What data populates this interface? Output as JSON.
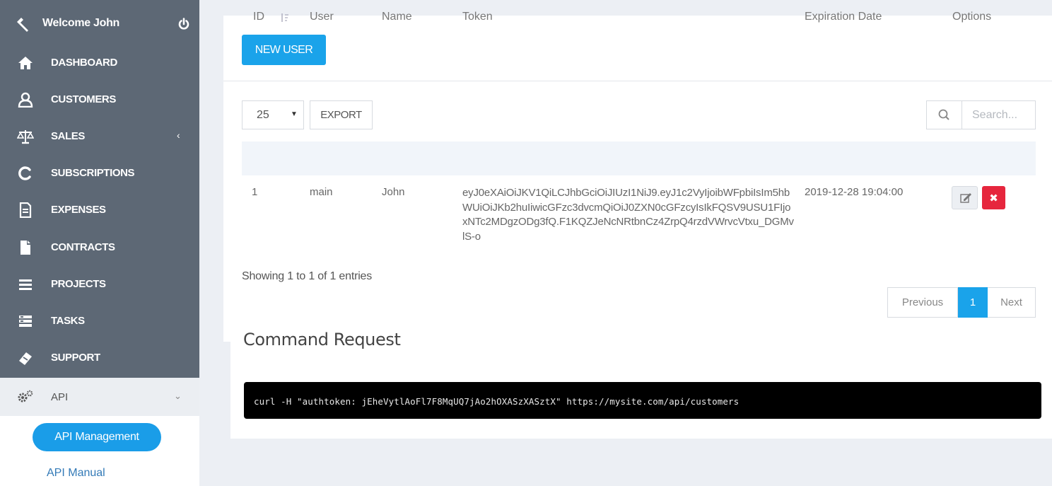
{
  "sidebar": {
    "welcome": "Welcome John",
    "items": [
      {
        "label": "DASHBOARD",
        "icon": "home-icon"
      },
      {
        "label": "CUSTOMERS",
        "icon": "user-icon"
      },
      {
        "label": "SALES",
        "icon": "balance-scale-icon",
        "chevron": "‹"
      },
      {
        "label": "SUBSCRIPTIONS",
        "icon": "refresh-c-icon"
      },
      {
        "label": "EXPENSES",
        "icon": "document-icon"
      },
      {
        "label": "CONTRACTS",
        "icon": "file-icon"
      },
      {
        "label": "PROJECTS",
        "icon": "bars-icon"
      },
      {
        "label": "TASKS",
        "icon": "tasks-list-icon"
      },
      {
        "label": "SUPPORT",
        "icon": "ticket-icon"
      }
    ],
    "api": {
      "label": "API",
      "icon": "cogs-icon",
      "chevron": "⌄"
    },
    "api_management": "API Management",
    "api_manual": "API Manual"
  },
  "toolbar": {
    "new_user": "NEW USER"
  },
  "table_controls": {
    "page_length": "25",
    "export": "EXPORT",
    "search_placeholder": "Search..."
  },
  "table": {
    "columns": [
      "ID",
      "User",
      "Name",
      "Token",
      "Expiration Date",
      "Options"
    ],
    "rows": [
      {
        "id": "1",
        "user": "main",
        "name": "John",
        "token": "eyJ0eXAiOiJKV1QiLCJhbGciOiJIUzI1NiJ9.eyJ1c2VyIjoibWFpbiIsIm5hbWUiOiJKb2huIiwicGFzc3dvcmQiOiJ0ZXN0cGFzcyIsIkFQSV9USU1FIjoxNTc2MDgzODg3fQ.F1KQZJeNcNRtbnCz4ZrpQ4rzdVWrvcVtxu_DGMvlS-o",
        "expiration": "2019-12-28 19:04:00"
      }
    ],
    "info": "Showing 1 to 1 of 1 entries"
  },
  "pagination": {
    "previous": "Previous",
    "current": "1",
    "next": "Next"
  },
  "command": {
    "title": "Command Request",
    "code": "curl -H \"authtoken: jEheVytlAoFl7F8MqUQ7jAo2hOXASzXASztX\" https://mysite.com/api/customers"
  },
  "colors": {
    "sidebar_bg": "#5d6875",
    "accent": "#1aa3ea",
    "delete": "#e6263d",
    "page_bg": "#eceff4"
  }
}
